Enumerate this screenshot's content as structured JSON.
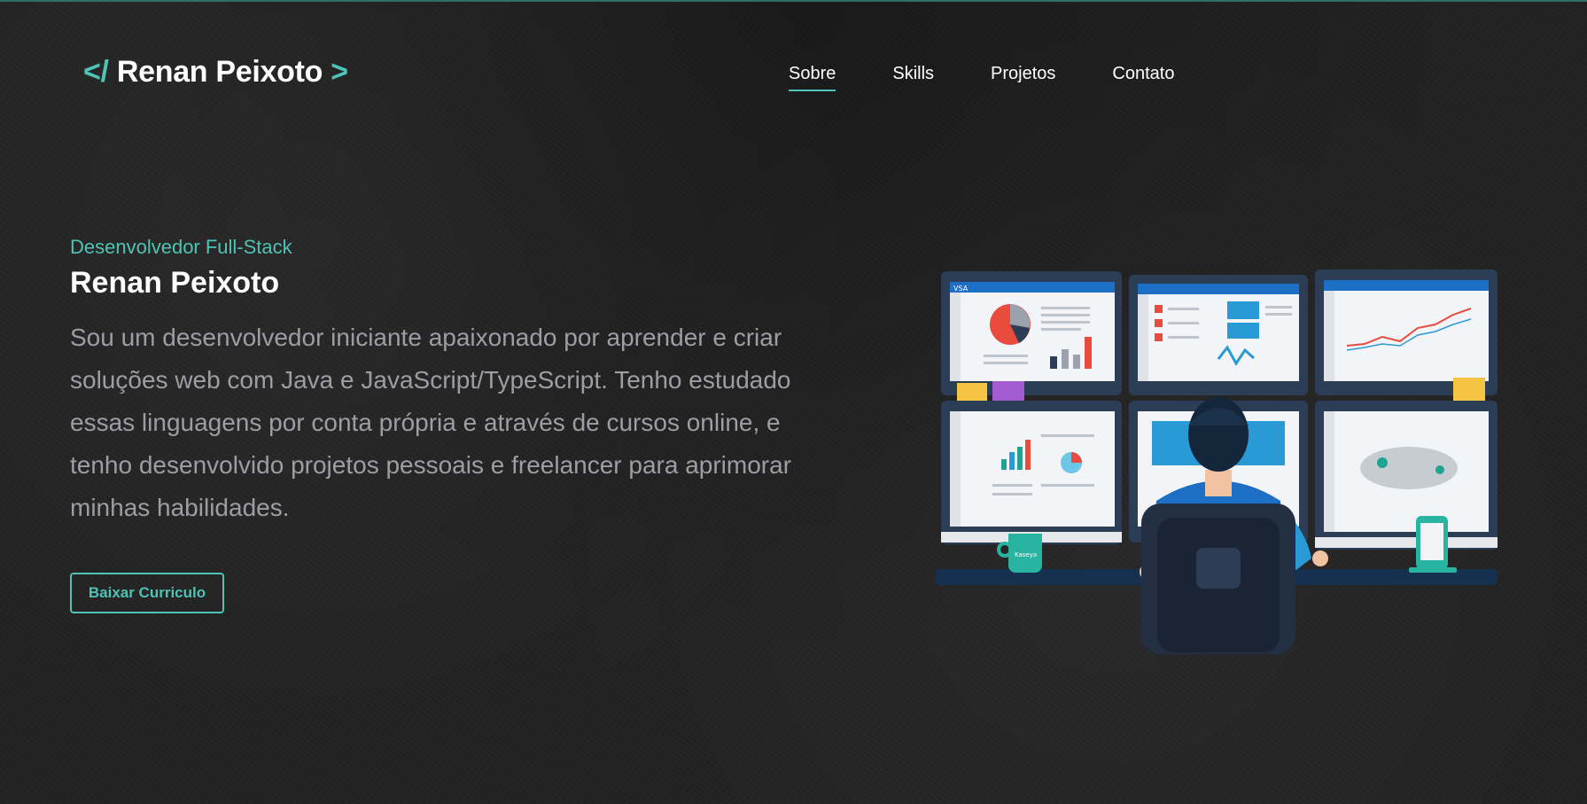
{
  "header": {
    "logo": {
      "open": "</",
      "name": "Renan Peixoto",
      "close": ">"
    },
    "nav": [
      {
        "label": "Sobre",
        "active": true
      },
      {
        "label": "Skills",
        "active": false
      },
      {
        "label": "Projetos",
        "active": false
      },
      {
        "label": "Contato",
        "active": false
      }
    ]
  },
  "hero": {
    "subtitle": "Desenvolvedor Full-Stack",
    "name": "Renan Peixoto",
    "description": "Sou um desenvolvedor iniciante apaixonado por aprender e criar soluções web com Java e JavaScript/TypeScript. Tenho estudado essas linguagens por conta própria e através de cursos online, e tenho desenvolvido projetos pessoais e freelancer para aprimorar minhas habilidades.",
    "button_label": "Baixar Curriculo"
  },
  "illustration": {
    "name": "developer-monitors-illustration",
    "screen_brand": "VSA",
    "mug_label": "Kaseya"
  },
  "colors": {
    "accent": "#4fc3b5",
    "background": "#222222",
    "text": "#ffffff",
    "muted_text": "#9c9ea3"
  }
}
